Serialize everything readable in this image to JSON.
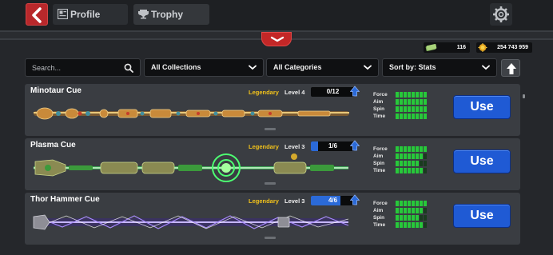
{
  "header": {
    "tabs": [
      {
        "label": "Profile",
        "icon": "profile-icon"
      },
      {
        "label": "Trophy Road",
        "icon": "trophy-icon"
      }
    ],
    "back_icon": "back-arrow-icon",
    "settings_icon": "gear-icon"
  },
  "currency": {
    "cash": "116",
    "coins": "254 743 959"
  },
  "filters": {
    "search_placeholder": "Search...",
    "collection": "All Collections",
    "category": "All Categories",
    "sort": "Sort by: Stats"
  },
  "stat_labels": [
    "Force",
    "Aim",
    "Spin",
    "Time"
  ],
  "colors": {
    "accent_red": "#c32727",
    "use_blue": "#1f5ad4",
    "legendary_gold": "#f2c21b",
    "stat_green": "#27c93a"
  },
  "cues": [
    {
      "name": "Minotaur Cue",
      "rarity": "Legendary",
      "level": "Level 4",
      "progress_text": "0/12",
      "progress_fraction": 0,
      "stats": {
        "Force": 8,
        "Aim": 8,
        "Spin": 8,
        "Time": 8
      },
      "use_label": "Use",
      "theme": "minotaur"
    },
    {
      "name": "Plasma Cue",
      "rarity": "Legendary",
      "level": "Level 3",
      "progress_text": "1/6",
      "progress_fraction": 0.17,
      "stats": {
        "Force": 8,
        "Aim": 7,
        "Spin": 6,
        "Time": 7
      },
      "use_label": "Use",
      "theme": "plasma"
    },
    {
      "name": "Thor Hammer Cue",
      "rarity": "Legendary",
      "level": "Level 3",
      "progress_text": "4/6",
      "progress_fraction": 0.67,
      "stats": {
        "Force": 8,
        "Aim": 7,
        "Spin": 6,
        "Time": 7
      },
      "use_label": "Use",
      "theme": "thor"
    }
  ]
}
